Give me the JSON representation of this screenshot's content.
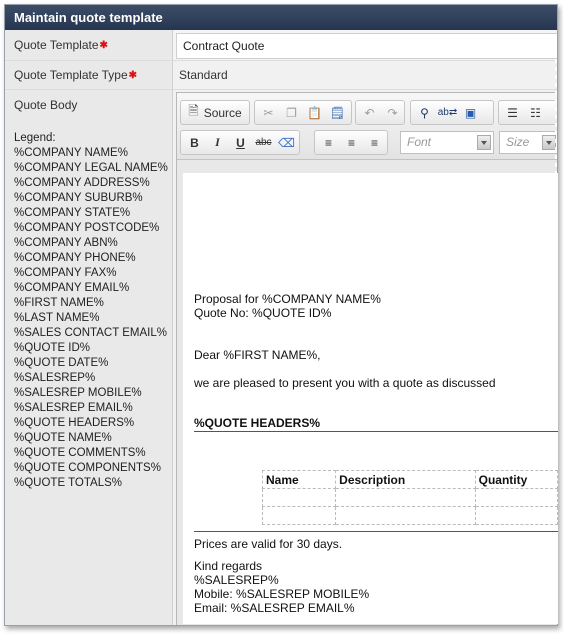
{
  "window": {
    "title": "Maintain quote template"
  },
  "form": {
    "quote_template_label": "Quote Template",
    "quote_template_value": "Contract Quote",
    "quote_template_type_label": "Quote Template Type",
    "quote_template_type_value": "Standard",
    "quote_body_label": "Quote Body",
    "legend_title": "Legend:",
    "legend_items": [
      "%COMPANY NAME%",
      "%COMPANY LEGAL NAME%",
      "%COMPANY ADDRESS%",
      "%COMPANY SUBURB%",
      "%COMPANY STATE%",
      "%COMPANY POSTCODE%",
      "%COMPANY ABN%",
      "%COMPANY PHONE%",
      "%COMPANY FAX%",
      "%COMPANY EMAIL%",
      "%FIRST NAME%",
      "%LAST NAME%",
      "%SALES CONTACT EMAIL%",
      "%QUOTE ID%",
      "%QUOTE DATE%",
      "%SALESREP%",
      "%SALESREP MOBILE%",
      "%SALESREP EMAIL%",
      "%QUOTE HEADERS%",
      "%QUOTE NAME%",
      "%QUOTE COMMENTS%",
      "%QUOTE COMPONENTS%",
      "%QUOTE TOTALS%"
    ]
  },
  "toolbar": {
    "source_label": "Source",
    "bold": "B",
    "italic": "I",
    "underline": "U",
    "strike": "abc",
    "font_placeholder": "Font",
    "size_placeholder": "Size"
  },
  "document": {
    "line_proposal": "Proposal for %COMPANY NAME%",
    "line_quote_no": "Quote No: %QUOTE ID%",
    "greeting": "Dear %FIRST NAME%,",
    "intro": "we are pleased to present you with a quote as discussed",
    "headers_placeholder": "%QUOTE HEADERS%",
    "table_headers": [
      "Name",
      "Description",
      "Quantity"
    ],
    "validity": "Prices are valid for 30 days.",
    "closing": "Kind regards",
    "salesrep": "%SALESREP%",
    "mobile": "Mobile: %SALESREP MOBILE%",
    "email": "Email: %SALESREP EMAIL%"
  }
}
